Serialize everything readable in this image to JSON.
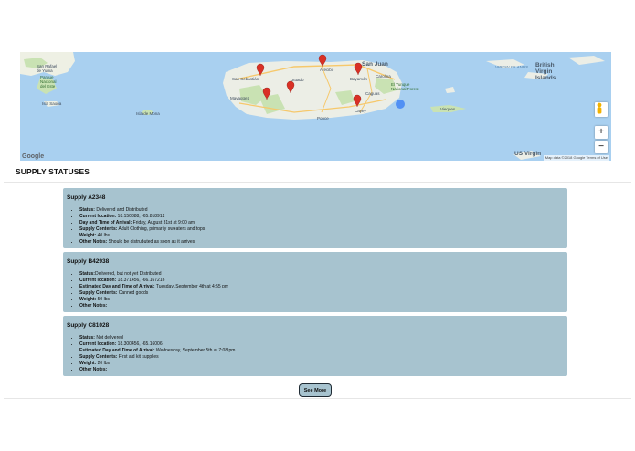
{
  "map": {
    "labels": {
      "san_rafael": "San Rafael\nde Yuma",
      "parque_del_este": "Parque\nNacional\ndel Este",
      "isla_saona": "Isla Saona",
      "isla_de_mona": "Isla de Mona",
      "san_sebastian": "San Sebastián",
      "mayaguez": "Mayagüez",
      "san_juan": "San Juan",
      "bayamon": "Bayamón",
      "carolina": "Carolina",
      "caguas": "Caguas",
      "el_yunque": "El Yunque\nNational Forest",
      "ponce": "Ponce",
      "cayey": "Cayey",
      "arecibo": "Arecibo",
      "utuado": "Utuado",
      "british_virgin_islands": "British\nVirgin\nIslands",
      "virgin_islands": "VIRGIN ISLANDS",
      "us_virgin": "US Virgin",
      "vieques": "Vieques"
    },
    "marker_color": "#d93025",
    "cluster_color": "#4285f4",
    "pegman_icon": "pegman-icon",
    "zoom_in_label": "+",
    "zoom_out_label": "−",
    "google_label": "Google",
    "attribution": "Map data ©2018 Google  Terms of Use"
  },
  "page": {
    "section_title": "SUPPLY STATUSES",
    "see_more_label": "See More"
  },
  "supplies": [
    {
      "title": "Supply A2348",
      "items": [
        {
          "label": "Status:",
          "value": " Delivered and Distributed"
        },
        {
          "label": "Current location:",
          "value": " 18.150888, -65.818912"
        },
        {
          "label": "Day and Time of Arrival:",
          "value": " Friday, August 31st at 9:00 am"
        },
        {
          "label": "Supply Contents:",
          "value": " Adult Clothing, primarily sweaters and tops"
        },
        {
          "label": "Weight:",
          "value": " 40 lbs"
        },
        {
          "label": "Other Notes:",
          "value": " Should be distrubuted as soon as it arrives"
        }
      ]
    },
    {
      "title": "Supply B42938",
      "items": [
        {
          "label": "Status:",
          "value": "Delivered, but not yet Distributed"
        },
        {
          "label": "Current location:",
          "value": " 18.371456, -66.167216"
        },
        {
          "label": "Estimated Day and Time of Arrival:",
          "value": " Tuesday, September 4th at 4:55 pm"
        },
        {
          "label": "Supply Contents:",
          "value": " Canned goods"
        },
        {
          "label": "Weight:",
          "value": " 50 lbs"
        },
        {
          "label": "Other Notes:",
          "value": ""
        }
      ]
    },
    {
      "title": "Supply C81028",
      "items": [
        {
          "label": "Status:",
          "value": " Not delivered"
        },
        {
          "label": "Current location:",
          "value": " 18.300456, -65.16006"
        },
        {
          "label": "Estimated Day and Time of Arrival:",
          "value": " Wednesday, September 5th at 7:08 pm"
        },
        {
          "label": "Supply Contents:",
          "value": " First aid kit supplies"
        },
        {
          "label": "Weight:",
          "value": " 20 lbs"
        },
        {
          "label": "Other Notes:",
          "value": ""
        }
      ]
    }
  ]
}
